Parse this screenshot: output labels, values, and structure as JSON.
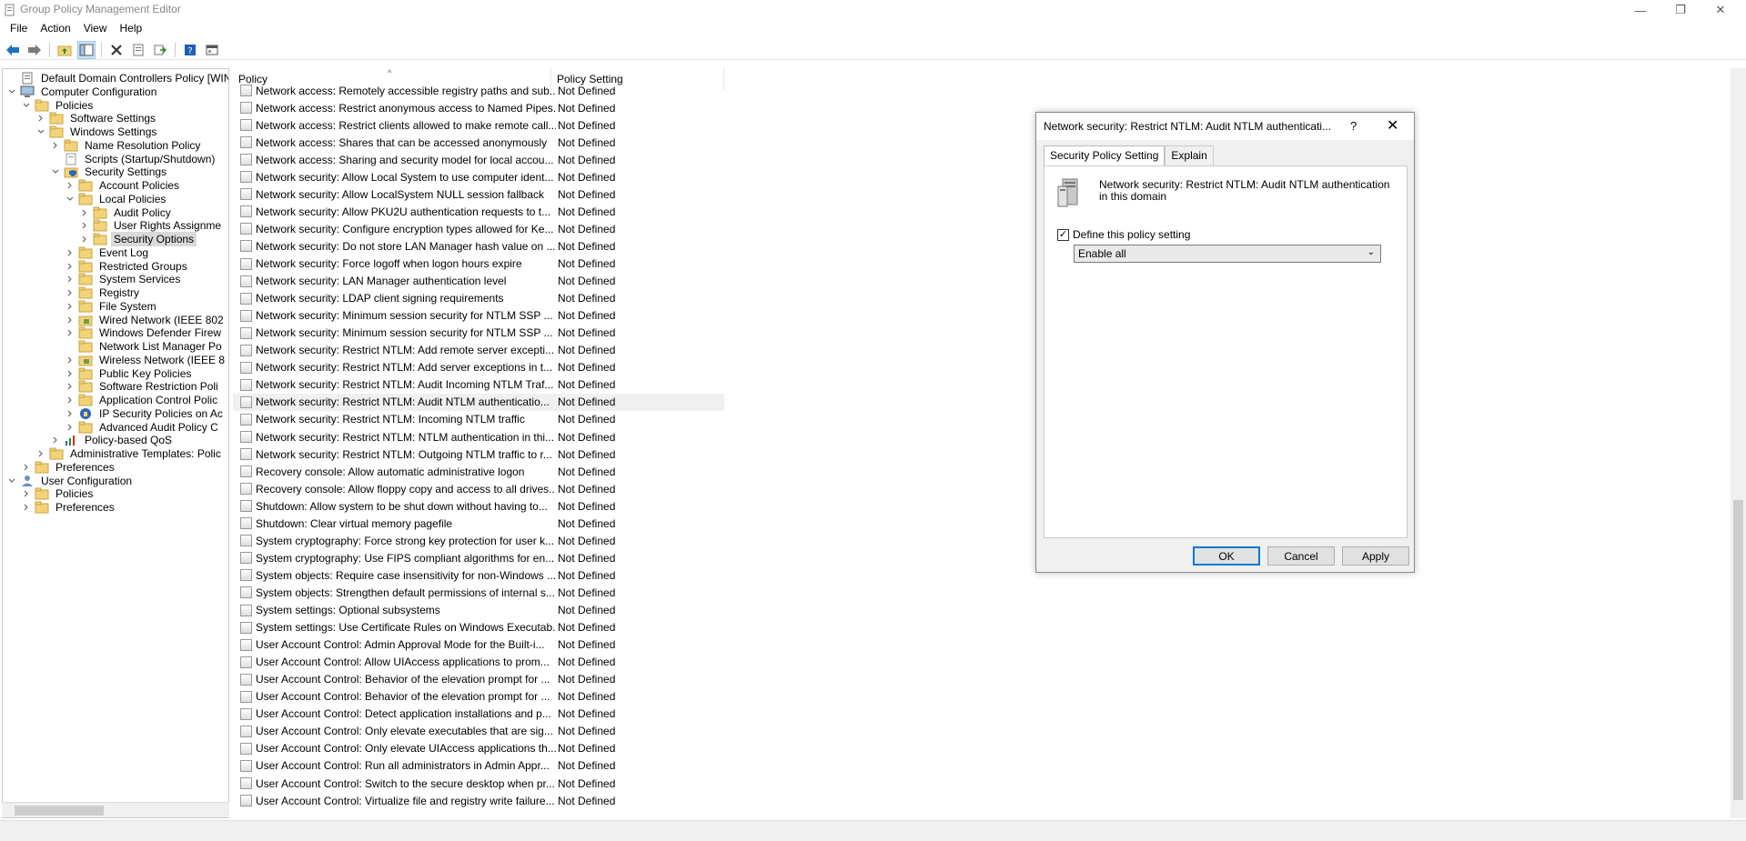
{
  "window": {
    "title": "Group Policy Management Editor",
    "minimize": "—",
    "restore": "❐",
    "close": "✕"
  },
  "menu": [
    "File",
    "Action",
    "View",
    "Help"
  ],
  "toolbar": {
    "icons": [
      "back-arrow-icon",
      "forward-arrow-icon",
      "up-folder-icon",
      "show-hide-tree-icon",
      "delete-icon",
      "properties-icon",
      "export-icon",
      "help-icon",
      "console-icon"
    ]
  },
  "tree": {
    "items": [
      {
        "label": "Default Domain Controllers Policy [WIN-TI",
        "level": 0,
        "twisty": "",
        "icon": "policy"
      },
      {
        "label": "Computer Configuration",
        "level": 0,
        "twisty": "v",
        "icon": "computer"
      },
      {
        "label": "Policies",
        "level": 1,
        "twisty": "v",
        "icon": "folder"
      },
      {
        "label": "Software Settings",
        "level": 2,
        "twisty": ">",
        "icon": "folder"
      },
      {
        "label": "Windows Settings",
        "level": 2,
        "twisty": "v",
        "icon": "folder"
      },
      {
        "label": "Name Resolution Policy",
        "level": 3,
        "twisty": ">",
        "icon": "folder"
      },
      {
        "label": "Scripts (Startup/Shutdown)",
        "level": 3,
        "twisty": "",
        "icon": "script"
      },
      {
        "label": "Security Settings",
        "level": 3,
        "twisty": "v",
        "icon": "security"
      },
      {
        "label": "Account Policies",
        "level": 4,
        "twisty": ">",
        "icon": "folder"
      },
      {
        "label": "Local Policies",
        "level": 4,
        "twisty": "v",
        "icon": "folder"
      },
      {
        "label": "Audit Policy",
        "level": 5,
        "twisty": ">",
        "icon": "folder"
      },
      {
        "label": "User Rights Assignme",
        "level": 5,
        "twisty": ">",
        "icon": "folder"
      },
      {
        "label": "Security Options",
        "level": 5,
        "twisty": ">",
        "icon": "folder",
        "selected": true
      },
      {
        "label": "Event Log",
        "level": 4,
        "twisty": ">",
        "icon": "folder"
      },
      {
        "label": "Restricted Groups",
        "level": 4,
        "twisty": ">",
        "icon": "folder"
      },
      {
        "label": "System Services",
        "level": 4,
        "twisty": ">",
        "icon": "folder"
      },
      {
        "label": "Registry",
        "level": 4,
        "twisty": ">",
        "icon": "folder"
      },
      {
        "label": "File System",
        "level": 4,
        "twisty": ">",
        "icon": "folder"
      },
      {
        "label": "Wired Network (IEEE 802",
        "level": 4,
        "twisty": ">",
        "icon": "network"
      },
      {
        "label": "Windows Defender Firew",
        "level": 4,
        "twisty": ">",
        "icon": "folder"
      },
      {
        "label": "Network List Manager Po",
        "level": 4,
        "twisty": "",
        "icon": "folder"
      },
      {
        "label": "Wireless Network (IEEE 8",
        "level": 4,
        "twisty": ">",
        "icon": "network"
      },
      {
        "label": "Public Key Policies",
        "level": 4,
        "twisty": ">",
        "icon": "folder"
      },
      {
        "label": "Software Restriction Poli",
        "level": 4,
        "twisty": ">",
        "icon": "folder"
      },
      {
        "label": "Application Control Polic",
        "level": 4,
        "twisty": ">",
        "icon": "folder"
      },
      {
        "label": "IP Security Policies on Ac",
        "level": 4,
        "twisty": ">",
        "icon": "ipsec"
      },
      {
        "label": "Advanced Audit Policy C",
        "level": 4,
        "twisty": ">",
        "icon": "folder"
      },
      {
        "label": "Policy-based QoS",
        "level": 3,
        "twisty": ">",
        "icon": "qos"
      },
      {
        "label": "Administrative Templates: Polic",
        "level": 2,
        "twisty": ">",
        "icon": "folder"
      },
      {
        "label": "Preferences",
        "level": 1,
        "twisty": ">",
        "icon": "folder"
      },
      {
        "label": "User Configuration",
        "level": 0,
        "twisty": "v",
        "icon": "user"
      },
      {
        "label": "Policies",
        "level": 1,
        "twisty": ">",
        "icon": "folder"
      },
      {
        "label": "Preferences",
        "level": 1,
        "twisty": ">",
        "icon": "folder"
      }
    ]
  },
  "list": {
    "columns": [
      "Policy",
      "Policy Setting"
    ],
    "rows": [
      {
        "policy": "Network access: Remotely accessible registry paths and sub...",
        "setting": "Not Defined"
      },
      {
        "policy": "Network access: Restrict anonymous access to Named Pipes...",
        "setting": "Not Defined"
      },
      {
        "policy": "Network access: Restrict clients allowed to make remote call...",
        "setting": "Not Defined"
      },
      {
        "policy": "Network access: Shares that can be accessed anonymously",
        "setting": "Not Defined"
      },
      {
        "policy": "Network access: Sharing and security model for local accou...",
        "setting": "Not Defined"
      },
      {
        "policy": "Network security: Allow Local System to use computer ident...",
        "setting": "Not Defined"
      },
      {
        "policy": "Network security: Allow LocalSystem NULL session fallback",
        "setting": "Not Defined"
      },
      {
        "policy": "Network security: Allow PKU2U authentication requests to t...",
        "setting": "Not Defined"
      },
      {
        "policy": "Network security: Configure encryption types allowed for Ke...",
        "setting": "Not Defined"
      },
      {
        "policy": "Network security: Do not store LAN Manager hash value on ...",
        "setting": "Not Defined"
      },
      {
        "policy": "Network security: Force logoff when logon hours expire",
        "setting": "Not Defined"
      },
      {
        "policy": "Network security: LAN Manager authentication level",
        "setting": "Not Defined"
      },
      {
        "policy": "Network security: LDAP client signing requirements",
        "setting": "Not Defined"
      },
      {
        "policy": "Network security: Minimum session security for NTLM SSP ...",
        "setting": "Not Defined"
      },
      {
        "policy": "Network security: Minimum session security for NTLM SSP ...",
        "setting": "Not Defined"
      },
      {
        "policy": "Network security: Restrict NTLM: Add remote server excepti...",
        "setting": "Not Defined"
      },
      {
        "policy": "Network security: Restrict NTLM: Add server exceptions in t...",
        "setting": "Not Defined"
      },
      {
        "policy": "Network security: Restrict NTLM: Audit Incoming NTLM Traf...",
        "setting": "Not Defined"
      },
      {
        "policy": "Network security: Restrict NTLM: Audit NTLM authenticatio...",
        "setting": "Not Defined",
        "selected": true
      },
      {
        "policy": "Network security: Restrict NTLM: Incoming NTLM traffic",
        "setting": "Not Defined"
      },
      {
        "policy": "Network security: Restrict NTLM: NTLM authentication in thi...",
        "setting": "Not Defined"
      },
      {
        "policy": "Network security: Restrict NTLM: Outgoing NTLM traffic to r...",
        "setting": "Not Defined"
      },
      {
        "policy": "Recovery console: Allow automatic administrative logon",
        "setting": "Not Defined"
      },
      {
        "policy": "Recovery console: Allow floppy copy and access to all drives...",
        "setting": "Not Defined"
      },
      {
        "policy": "Shutdown: Allow system to be shut down without having to...",
        "setting": "Not Defined"
      },
      {
        "policy": "Shutdown: Clear virtual memory pagefile",
        "setting": "Not Defined"
      },
      {
        "policy": "System cryptography: Force strong key protection for user k...",
        "setting": "Not Defined"
      },
      {
        "policy": "System cryptography: Use FIPS compliant algorithms for en...",
        "setting": "Not Defined"
      },
      {
        "policy": "System objects: Require case insensitivity for non-Windows ...",
        "setting": "Not Defined"
      },
      {
        "policy": "System objects: Strengthen default permissions of internal s...",
        "setting": "Not Defined"
      },
      {
        "policy": "System settings: Optional subsystems",
        "setting": "Not Defined"
      },
      {
        "policy": "System settings: Use Certificate Rules on Windows Executab...",
        "setting": "Not Defined"
      },
      {
        "policy": "User Account Control: Admin Approval Mode for the Built-i...",
        "setting": "Not Defined"
      },
      {
        "policy": "User Account Control: Allow UIAccess applications to prom...",
        "setting": "Not Defined"
      },
      {
        "policy": "User Account Control: Behavior of the elevation prompt for ...",
        "setting": "Not Defined"
      },
      {
        "policy": "User Account Control: Behavior of the elevation prompt for ...",
        "setting": "Not Defined"
      },
      {
        "policy": "User Account Control: Detect application installations and p...",
        "setting": "Not Defined"
      },
      {
        "policy": "User Account Control: Only elevate executables that are sig...",
        "setting": "Not Defined"
      },
      {
        "policy": "User Account Control: Only elevate UIAccess applications th...",
        "setting": "Not Defined"
      },
      {
        "policy": "User Account Control: Run all administrators in Admin Appr...",
        "setting": "Not Defined"
      },
      {
        "policy": "User Account Control: Switch to the secure desktop when pr...",
        "setting": "Not Defined"
      },
      {
        "policy": "User Account Control: Virtualize file and registry write failure...",
        "setting": "Not Defined"
      }
    ]
  },
  "dialog": {
    "title": "Network security: Restrict NTLM: Audit NTLM authenticati...",
    "help": "?",
    "close": "✕",
    "tabs": [
      "Security Policy Setting",
      "Explain"
    ],
    "policy_name": "Network security: Restrict NTLM: Audit NTLM authentication in this domain",
    "checkbox_label": "Define this policy setting",
    "checkbox_mark": "✓",
    "checked": true,
    "selected_option": "Enable all",
    "buttons": {
      "ok": "OK",
      "cancel": "Cancel",
      "apply": "Apply"
    }
  }
}
